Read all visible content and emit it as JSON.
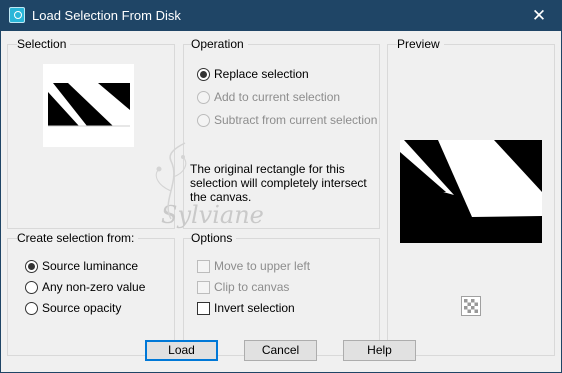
{
  "window": {
    "title": "Load Selection From Disk",
    "close_glyph": "✕"
  },
  "selection": {
    "label": "Selection"
  },
  "operation": {
    "label": "Operation",
    "options": [
      {
        "label": "Replace selection",
        "checked": true,
        "disabled": false
      },
      {
        "label": "Add to current selection",
        "checked": false,
        "disabled": true
      },
      {
        "label": "Subtract from current selection",
        "checked": false,
        "disabled": true
      }
    ],
    "message": "The original rectangle for this selection will completely intersect the canvas."
  },
  "preview": {
    "label": "Preview",
    "checker_icon": "checkerboard-icon"
  },
  "create_from": {
    "label": "Create selection from:",
    "options": [
      {
        "label": "Source luminance",
        "checked": true
      },
      {
        "label": "Any non-zero value",
        "checked": false
      },
      {
        "label": "Source opacity",
        "checked": false
      }
    ]
  },
  "options": {
    "label": "Options",
    "items": [
      {
        "label": "Move to upper left",
        "checked": false,
        "disabled": true
      },
      {
        "label": "Clip to canvas",
        "checked": false,
        "disabled": true
      },
      {
        "label": "Invert selection",
        "checked": false,
        "disabled": false
      }
    ]
  },
  "buttons": {
    "load": "Load",
    "cancel": "Cancel",
    "help": "Help"
  },
  "watermark": {
    "text": "Sylviane"
  }
}
